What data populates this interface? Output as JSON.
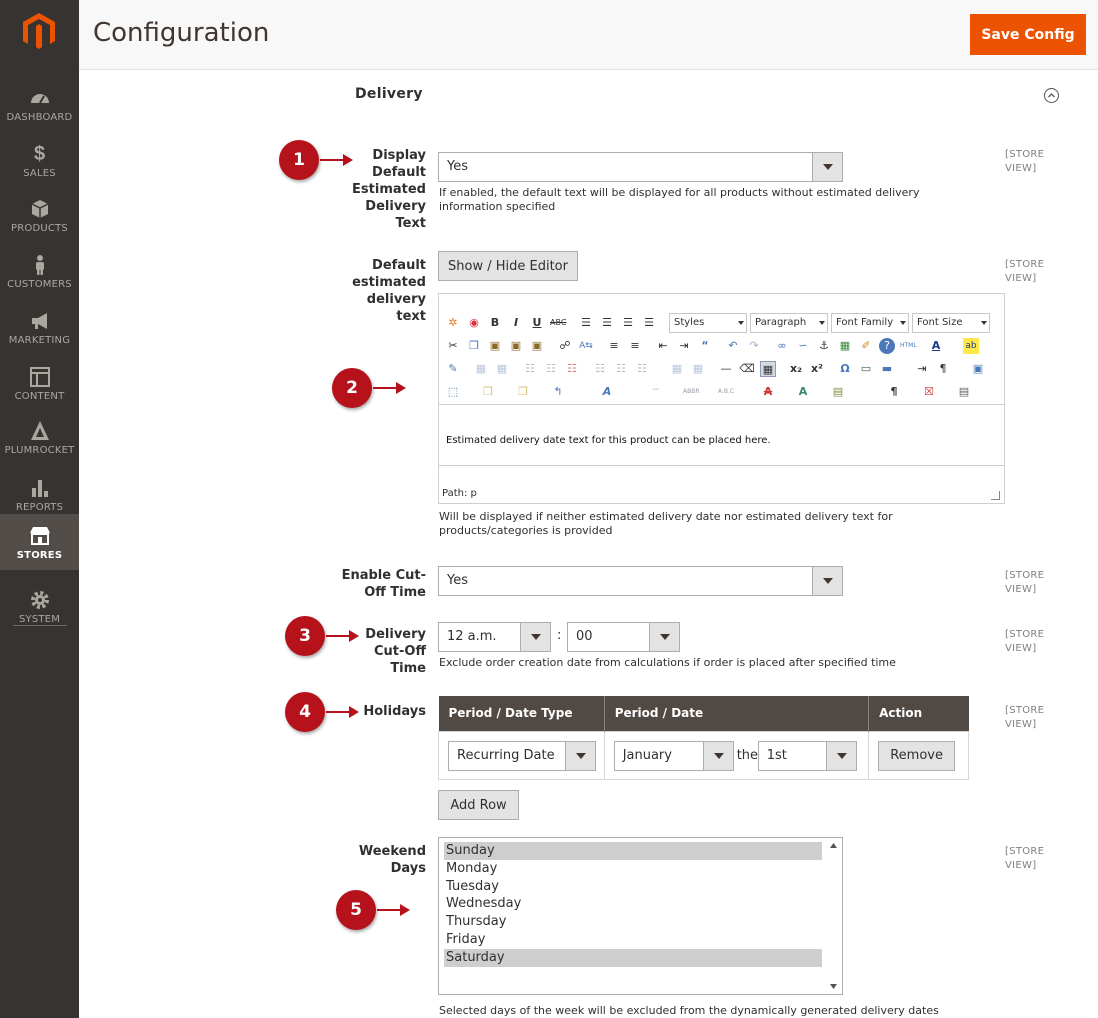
{
  "sidebar": {
    "logo_icon": "magento-logo-icon",
    "items": [
      {
        "label": "DASHBOARD",
        "icon": "dashboard-icon"
      },
      {
        "label": "SALES",
        "icon": "dollar-icon"
      },
      {
        "label": "PRODUCTS",
        "icon": "cube-icon"
      },
      {
        "label": "CUSTOMERS",
        "icon": "person-icon"
      },
      {
        "label": "MARKETING",
        "icon": "megaphone-icon"
      },
      {
        "label": "CONTENT",
        "icon": "layout-icon"
      },
      {
        "label": "PLUMROCKET",
        "icon": "rocket-icon"
      },
      {
        "label": "REPORTS",
        "icon": "bar-chart-icon"
      },
      {
        "label": "STORES",
        "icon": "store-icon",
        "active": true
      },
      {
        "label": "SYSTEM",
        "icon": "gear-icon"
      }
    ]
  },
  "header": {
    "title": "Configuration",
    "save_label": "Save Config"
  },
  "section": {
    "title": "Delivery"
  },
  "scope_label": "[STORE VIEW]",
  "fields": {
    "display_default": {
      "label": "Display Default Estimated Delivery Text",
      "value": "Yes",
      "note": "If enabled, the default text will be displayed for all products without estimated delivery information specified"
    },
    "default_text": {
      "label": "Default estimated delivery text",
      "toggle_label": "Show / Hide Editor",
      "toolbar_selects": [
        "Styles",
        "Paragraph",
        "Font Family",
        "Font Size"
      ],
      "content": "Estimated delivery date text for this product can be placed here.",
      "path": "Path: p",
      "note": "Will be displayed if neither estimated delivery date nor estimated delivery text for products/categories is provided"
    },
    "cutoff_enable": {
      "label": "Enable Cut-Off Time",
      "value": "Yes"
    },
    "cutoff_time": {
      "label": "Delivery Cut-Off Time",
      "hour": "12 a.m.",
      "separator": ":",
      "minute": "00",
      "note": "Exclude order creation date from calculations if order is placed after specified time"
    },
    "holidays": {
      "label": "Holidays",
      "columns": [
        "Period / Date Type",
        "Period / Date",
        "Action"
      ],
      "row": {
        "type": "Recurring Date",
        "month": "January",
        "the": "the",
        "day": "1st",
        "remove": "Remove"
      },
      "add_row": "Add Row"
    },
    "weekend": {
      "label": "Weekend Days",
      "options": [
        {
          "label": "Sunday",
          "selected": true
        },
        {
          "label": "Monday",
          "selected": false
        },
        {
          "label": "Tuesday",
          "selected": false
        },
        {
          "label": "Wednesday",
          "selected": false
        },
        {
          "label": "Thursday",
          "selected": false
        },
        {
          "label": "Friday",
          "selected": false
        },
        {
          "label": "Saturday",
          "selected": true
        }
      ],
      "note": "Selected days of the week will be excluded from the dynamically generated delivery dates"
    }
  },
  "callouts": [
    "1",
    "2",
    "3",
    "4",
    "5"
  ],
  "colors": {
    "accent": "#eb5202",
    "sidebar": "#373330",
    "callout": "#b5121b",
    "table_header": "#514943"
  }
}
